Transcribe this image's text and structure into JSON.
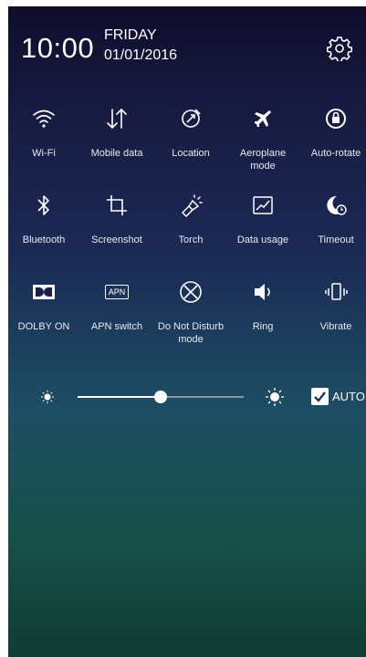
{
  "header": {
    "time": "10:00",
    "day": "FRIDAY",
    "date": "01/01/2016"
  },
  "tiles": [
    {
      "label": "Wi-Fi",
      "icon": "wifi-icon"
    },
    {
      "label": "Mobile data",
      "icon": "mobile-data-icon"
    },
    {
      "label": "Location",
      "icon": "location-icon"
    },
    {
      "label": "Aeroplane mode",
      "icon": "airplane-icon"
    },
    {
      "label": "Auto-rotate",
      "icon": "auto-rotate-icon"
    },
    {
      "label": "Bluetooth",
      "icon": "bluetooth-icon"
    },
    {
      "label": "Screenshot",
      "icon": "crop-icon"
    },
    {
      "label": "Torch",
      "icon": "torch-icon"
    },
    {
      "label": "Data usage",
      "icon": "data-usage-icon"
    },
    {
      "label": "Timeout",
      "icon": "timeout-icon"
    },
    {
      "label": "DOLBY ON",
      "icon": "dolby-icon"
    },
    {
      "label": "APN switch",
      "icon": "apn-icon"
    },
    {
      "label": "Do Not Disturb mode",
      "icon": "do-not-disturb-icon"
    },
    {
      "label": "Ring",
      "icon": "volume-icon"
    },
    {
      "label": "Vibrate",
      "icon": "vibrate-icon"
    }
  ],
  "apn_badge": "APN",
  "brightness": {
    "level": 0.5,
    "auto_checked": true,
    "auto_label": "AUTO"
  },
  "colors": {
    "panel_top": "#0f0d2d",
    "panel_bottom": "#103c33",
    "icon": "#ffffff"
  }
}
